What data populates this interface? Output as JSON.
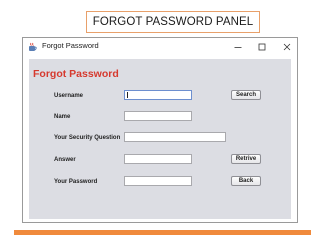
{
  "slide": {
    "title": "FORGOT PASSWORD PANEL"
  },
  "window": {
    "title": "Forgot Password",
    "icon": "java-cup-icon",
    "controls": {
      "minimize": "minimize-icon",
      "maximize": "maximize-icon",
      "close": "close-icon"
    }
  },
  "form": {
    "heading": "Forgot Password",
    "heading_color": "#d6392e",
    "fields": [
      {
        "label": "Username",
        "value": "",
        "placeholder": ""
      },
      {
        "label": "Name",
        "value": "",
        "placeholder": ""
      },
      {
        "label": "Your Security Question",
        "value": "",
        "placeholder": ""
      },
      {
        "label": "Answer",
        "value": "",
        "placeholder": ""
      },
      {
        "label": "Your Password",
        "value": "",
        "placeholder": ""
      }
    ],
    "buttons": {
      "search": "Search",
      "retrieve": "Retrive",
      "back": "Back"
    }
  },
  "colors": {
    "frame_border": "#e8a06a",
    "accent_bar": "#f08a3c",
    "panel_bg": "#dcdde3"
  }
}
